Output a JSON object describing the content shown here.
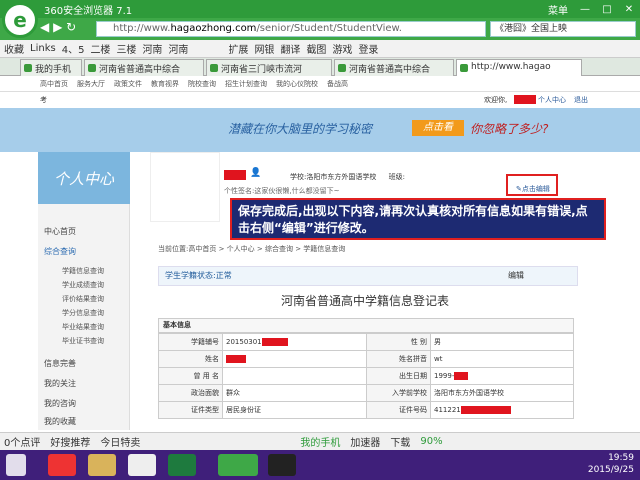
{
  "browser": {
    "title": "360安全浏览器 7.1",
    "menu_label": "菜单",
    "url_prefix": "http://www.",
    "url_domain": "hagaozhong.com",
    "url_path": "/senior/Student/StudentView.",
    "search_text": "《港囧》全国上映"
  },
  "bookmarks": [
    "收藏",
    "Links",
    "4、5",
    "二楼",
    "三楼",
    "河南",
    "河南",
    "扩展",
    "网银",
    "翻译",
    "截图",
    "游戏",
    "登录"
  ],
  "tabs": [
    "我的手机",
    "河南省普通高中综合",
    "河南省三门峡市流河",
    "河南省普通高中综合",
    "http://www.hagao"
  ],
  "site_nav": [
    "高中首页",
    "服务大厅",
    "政策文件",
    "教育视界",
    "院校查询",
    "招生计划查询",
    "我的心仪院校",
    "备战高"
  ],
  "user_bar": {
    "left": "考",
    "welcome": "欢迎你,",
    "center": "个人中心",
    "logout": "退出"
  },
  "banner": {
    "slogan": "潜藏在你大脑里的学习秘密",
    "button": "点击看",
    "question": "你忽略了多少?"
  },
  "sidebar": {
    "header": "个人中心",
    "items": [
      "中心首页",
      "综合查询",
      "信息完善",
      "我的关注",
      "我的咨询",
      "我的收藏"
    ],
    "sub_items": [
      "学籍信息查询",
      "学业成绩查询",
      "评价结果查询",
      "学分信息查询",
      "毕业结果查询",
      "毕业证书查询"
    ]
  },
  "profile": {
    "school_label": "学校:",
    "school": "洛阳市东方外国语学校",
    "class_label": "班级:",
    "signature": "个性签名:这家伙很懒,什么都没留下~",
    "edit": "点击编辑"
  },
  "annotation": "保存完成后,出现以下内容,请再次认真核对所有信息如果有错误,点击右侧“编辑”进行修改。",
  "breadcrumb": "当前位置:高中首页 > 个人中心 > 综合查询 > 学籍信息查询",
  "status": {
    "label": "学生学籍状态:",
    "value": "正常",
    "edit": "编辑"
  },
  "form_title": "河南省普通高中学籍信息登记表",
  "basic_info": "基本信息",
  "table": [
    [
      "学籍辅号",
      "20150301",
      "性 别",
      "男"
    ],
    [
      "姓名",
      "",
      "姓名拼音",
      "wt"
    ],
    [
      "曾 用 名",
      "",
      "出生日期",
      "1999-"
    ],
    [
      "政治面貌",
      "群众",
      "入学前学校",
      "洛阳市东方外国语学校"
    ],
    [
      "证件类型",
      "居民身份证",
      "证件号码",
      "411221"
    ]
  ],
  "statusbar": [
    "0个点评",
    "好搜推荐",
    "今日特卖",
    "我的手机",
    "加速器",
    "下载",
    "90%"
  ],
  "clock": {
    "time": "19:59",
    "date": "2015/9/25"
  },
  "colors": {
    "browser_green": "#2e9b3a",
    "annotation_bg": "#1d2a72",
    "redact": "#e0141e",
    "taskbar": "#3f1f7a"
  }
}
